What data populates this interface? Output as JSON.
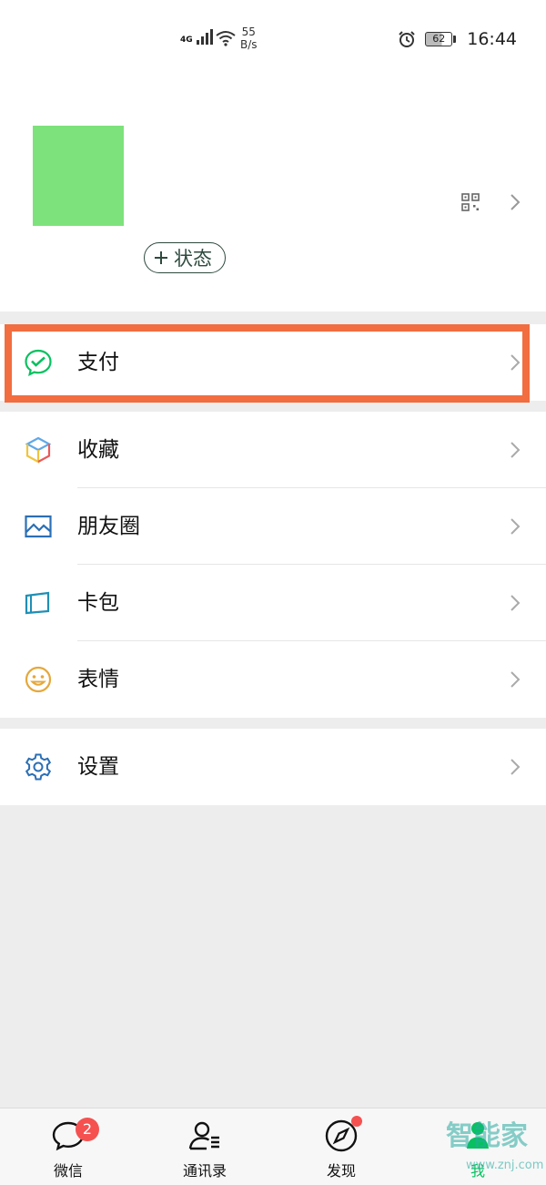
{
  "status_bar": {
    "network": "4G",
    "speed_value": "55",
    "speed_unit": "B/s",
    "battery": "62",
    "time": "16:44"
  },
  "profile": {
    "status_button": "状态"
  },
  "menu": {
    "pay": "支付",
    "favorites": "收藏",
    "moments": "朋友圈",
    "cards": "卡包",
    "stickers": "表情",
    "settings": "设置"
  },
  "tabbar": {
    "items": [
      {
        "label": "微信",
        "badge": "2"
      },
      {
        "label": "通讯录"
      },
      {
        "label": "发现"
      },
      {
        "label": "我"
      }
    ]
  },
  "watermark": {
    "main": "智能家",
    "sub": "www.znj.com"
  },
  "colors": {
    "accent_green": "#07c160",
    "highlight": "#f26d3f",
    "badge_red": "#f55151",
    "avatar": "#7de27b"
  }
}
